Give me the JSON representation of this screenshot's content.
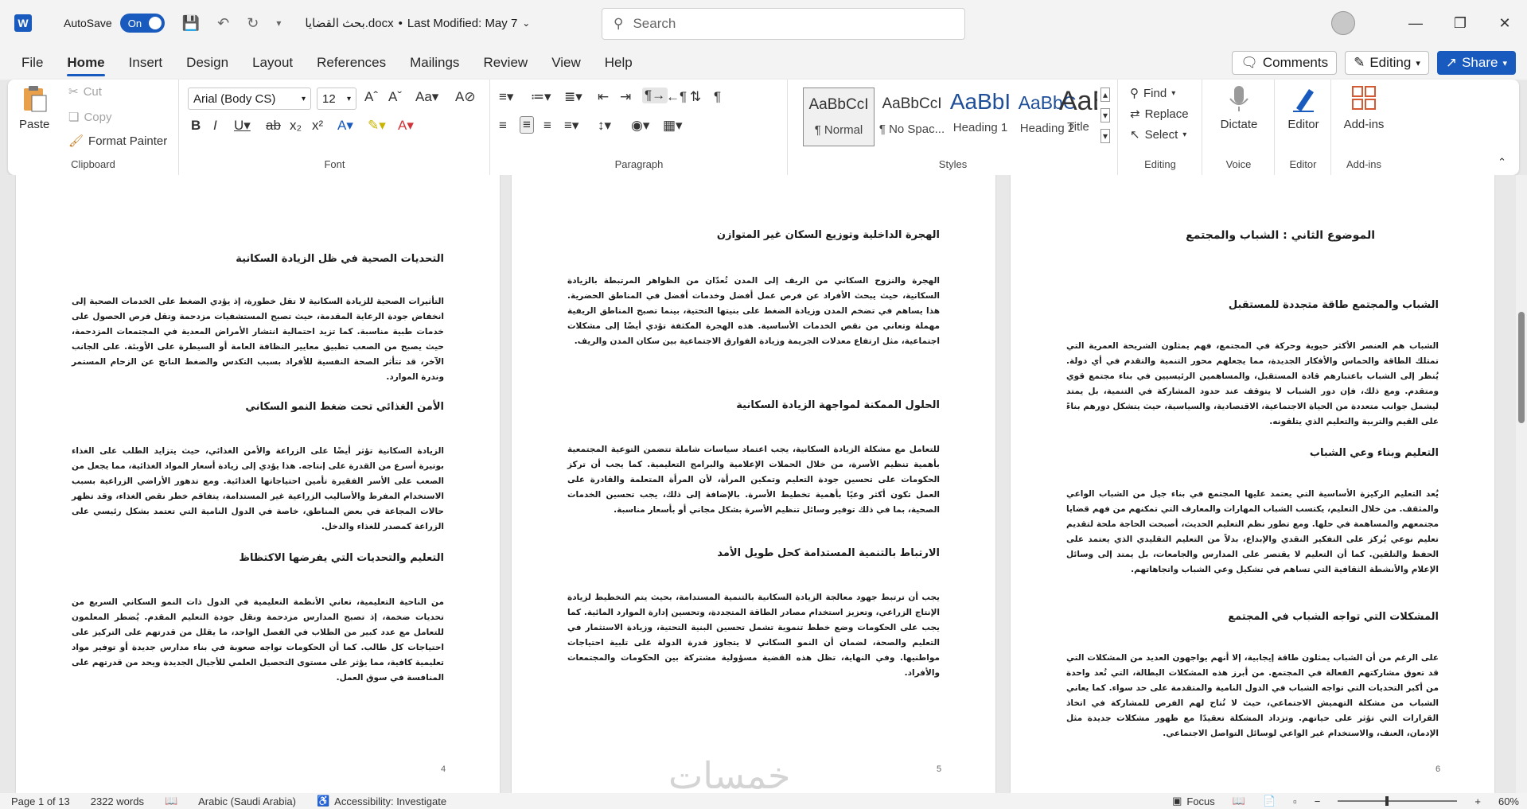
{
  "titlebar": {
    "autosave_label": "AutoSave",
    "autosave_state": "On",
    "doc_name": "بحث القضايا.docx",
    "separator": "•",
    "last_modified": "Last Modified: May 7",
    "search_placeholder": "Search"
  },
  "menu": [
    "File",
    "Home",
    "Insert",
    "Design",
    "Layout",
    "References",
    "Mailings",
    "Review",
    "View",
    "Help"
  ],
  "menu_right": {
    "comments": "Comments",
    "editing": "Editing",
    "share": "Share"
  },
  "ribbon": {
    "clipboard": {
      "label": "Clipboard",
      "paste": "Paste",
      "cut": "Cut",
      "copy": "Copy",
      "format_painter": "Format Painter"
    },
    "font": {
      "label": "Font",
      "font_name": "Arial (Body CS)",
      "font_size": "12"
    },
    "paragraph": {
      "label": "Paragraph"
    },
    "styles": {
      "label": "Styles",
      "items": [
        {
          "sample": "AaBbCcI",
          "name": "¶ Normal"
        },
        {
          "sample": "AaBbCcI",
          "name": "¶ No Spac..."
        },
        {
          "sample": "AaBbI",
          "name": "Heading 1"
        },
        {
          "sample": "AaBbC",
          "name": "Heading 2"
        },
        {
          "sample": "AaB",
          "name": "Title"
        }
      ]
    },
    "editing": {
      "label": "Editing",
      "find": "Find",
      "replace": "Replace",
      "select": "Select"
    },
    "voice": {
      "label": "Voice",
      "dictate": "Dictate"
    },
    "editor": {
      "label": "Editor",
      "editor": "Editor"
    },
    "addins": {
      "label": "Add-ins",
      "addins": "Add-ins"
    }
  },
  "pages": [
    {
      "number": "6",
      "sections": [
        {
          "heading": "الموضوع الثاني : الشباب والمجتمع",
          "text": ""
        },
        {
          "heading": "الشباب والمجتمع طاقة متجددة للمستقبل",
          "text": "الشباب هم العنصر الأكثر حيوية وحركة في المجتمع، فهم يمثلون الشريحة العمرية التي تمتلك الطاقة والحماس والأفكار الجديدة، مما يجعلهم محور التنمية والتقدم في أي دولة. يُنظر إلى الشباب باعتبارهم قادة المستقبل، والمساهمين الرئيسيين في بناء مجتمع قوي ومتقدم. ومع ذلك، فإن دور الشباب لا يتوقف عند حدود المشاركة في التنمية، بل يمتد ليشمل جوانب متعددة من الحياة الاجتماعية، الاقتصادية، والسياسية، حيث يتشكل دورهم بناءً على القيم والتربية والتعليم الذي يتلقونه."
        },
        {
          "heading": "التعليم وبناء وعي الشباب",
          "text": "يُعد التعليم الركيزة الأساسية التي يعتمد عليها المجتمع في بناء جيل من الشباب الواعي والمثقف. من خلال التعليم، يكتسب الشباب المهارات والمعارف التي تمكنهم من فهم قضايا مجتمعهم والمساهمة في حلها. ومع تطور نظم التعليم الحديث، أصبحت الحاجة ملحة لتقديم تعليم نوعي يُركز على التفكير النقدي والإبداع، بدلاً من التعليم التقليدي الذي يعتمد على الحفظ والتلقين. كما أن التعليم لا يقتصر على المدارس والجامعات، بل يمتد إلى وسائل الإعلام والأنشطة الثقافية التي تساهم في تشكيل وعي الشباب واتجاهاتهم."
        },
        {
          "heading": "المشكلات التي تواجه الشباب في المجتمع",
          "text": "على الرغم من أن الشباب يمثلون طاقة إيجابية، إلا أنهم يواجهون العديد من المشكلات التي قد تعوق مشاركتهم الفعالة في المجتمع. من أبرز هذه المشكلات البطالة، التي تُعد واحدة من أكبر التحديات التي تواجه الشباب في الدول النامية والمتقدمة على حد سواء. كما يعاني الشباب من مشكلة التهميش الاجتماعي، حيث لا تُتاح لهم الفرص للمشاركة في اتخاذ القرارات التي تؤثر على حياتهم. وتزداد المشكلة تعقيدًا مع ظهور مشكلات جديدة مثل الإدمان، العنف، والاستخدام غير الواعي لوسائل التواصل الاجتماعي."
        }
      ]
    },
    {
      "number": "5",
      "sections": [
        {
          "heading": "الهجرة الداخلية وتوزيع السكان غير المتوازن",
          "text": "الهجرة والنزوح السكاني من الريف إلى المدن تُعدّان من الظواهر المرتبطة بالزيادة السكانية، حيث يبحث الأفراد عن فرص عمل أفضل وخدمات أفضل في المناطق الحضرية. هذا يساهم في تضخم المدن وزيادة الضغط على بنيتها التحتية، بينما تصبح المناطق الريفية مهملة وتعاني من نقص الخدمات الأساسية. هذه الهجرة المكثفة تؤدي أيضًا إلى مشكلات اجتماعية، مثل ارتفاع معدلات الجريمة وزيادة الفوارق الاجتماعية بين سكان المدن والريف."
        },
        {
          "heading": "الحلول الممكنة لمواجهة الزيادة السكانية",
          "text": "للتعامل مع مشكلة الزيادة السكانية، يجب اعتماد سياسات شاملة تتضمن التوعية المجتمعية بأهمية تنظيم الأسرة، من خلال الحملات الإعلامية والبرامج التعليمية. كما يجب أن تركز الحكومات على تحسين جودة التعليم وتمكين المرأة، لأن المرأة المتعلمة والقادرة على العمل تكون أكثر وعيًا بأهمية تخطيط الأسرة. بالإضافة إلى ذلك، يجب تحسين الخدمات الصحية، بما في ذلك توفير وسائل تنظيم الأسرة بشكل مجاني أو بأسعار مناسبة."
        },
        {
          "heading": "الارتباط بالتنمية المستدامة كحل طويل الأمد",
          "text": "يجب أن ترتبط جهود معالجة الزيادة السكانية بالتنمية المستدامة، بحيث يتم التخطيط لزيادة الإنتاج الزراعي، وتعزيز استخدام مصادر الطاقة المتجددة، وتحسين إدارة الموارد المائية. كما يجب على الحكومات وضع خطط تنموية تشمل تحسين البنية التحتية، وزيادة الاستثمار في التعليم والصحة، لضمان أن النمو السكاني لا يتجاوز قدرة الدولة على تلبية احتياجات مواطنيها. وفي النهاية، تظل هذه القضية مسؤولية مشتركة بين الحكومات والمجتمعات والأفراد."
        }
      ]
    },
    {
      "number": "4",
      "sections": [
        {
          "heading": "التحديات الصحية في ظل الزيادة السكانية",
          "text": "التأثيرات الصحية للزيادة السكانية لا تقل خطورة، إذ يؤدي الضغط على الخدمات الصحية إلى انخفاض جودة الرعاية المقدمة، حيث تصبح المستشفيات مزدحمة وتقل فرص الحصول على خدمات طبية مناسبة. كما تزيد احتمالية انتشار الأمراض المعدية في المجتمعات المزدحمة، حيث يصبح من الصعب تطبيق معايير النظافة العامة أو السيطرة على الأوبئة. على الجانب الآخر، قد تتأثر الصحة النفسية للأفراد بسبب التكدس والضغط الناتج عن الزحام المستمر وندرة الموارد."
        },
        {
          "heading": "الأمن الغذائي تحت ضغط النمو السكاني",
          "text": "الزيادة السكانية تؤثر أيضًا على الزراعة والأمن الغذائي، حيث يتزايد الطلب على الغذاء بوتيرة أسرع من القدرة على إنتاجه. هذا يؤدي إلى زيادة أسعار المواد الغذائية، مما يجعل من الصعب على الأسر الفقيرة تأمين احتياجاتها الغذائية. ومع تدهور الأراضي الزراعية بسبب الاستخدام المفرط والأساليب الزراعية غير المستدامة، يتفاقم خطر نقص الغذاء، وقد تظهر حالات المجاعة في بعض المناطق، خاصة في الدول النامية التي تعتمد بشكل رئيسي على الزراعة كمصدر للغذاء والدخل."
        },
        {
          "heading": "التعليم والتحديات التي يفرضها الاكتظاظ",
          "text": "من الناحية التعليمية، تعاني الأنظمة التعليمية في الدول ذات النمو السكاني السريع من تحديات ضخمة، إذ تصبح المدارس مزدحمة ونقل جودة التعليم المقدم. يُضطر المعلمون للتعامل مع عدد كبير من الطلاب في الفصل الواحد، ما يقلل من قدرتهم على التركيز على احتياجات كل طالب. كما أن الحكومات تواجه صعوبة في بناء مدارس جديدة أو توفير مواد تعليمية كافية، مما يؤثر على مستوى التحصيل العلمي للأجيال الجديدة ويحد من قدرتهم على المنافسة في سوق العمل."
        }
      ]
    }
  ],
  "watermark": "خمسات",
  "statusbar": {
    "page": "Page 1 of 13",
    "words": "2322 words",
    "language": "Arabic (Saudi Arabia)",
    "accessibility": "Accessibility: Investigate",
    "focus": "Focus",
    "zoom": "60%"
  }
}
